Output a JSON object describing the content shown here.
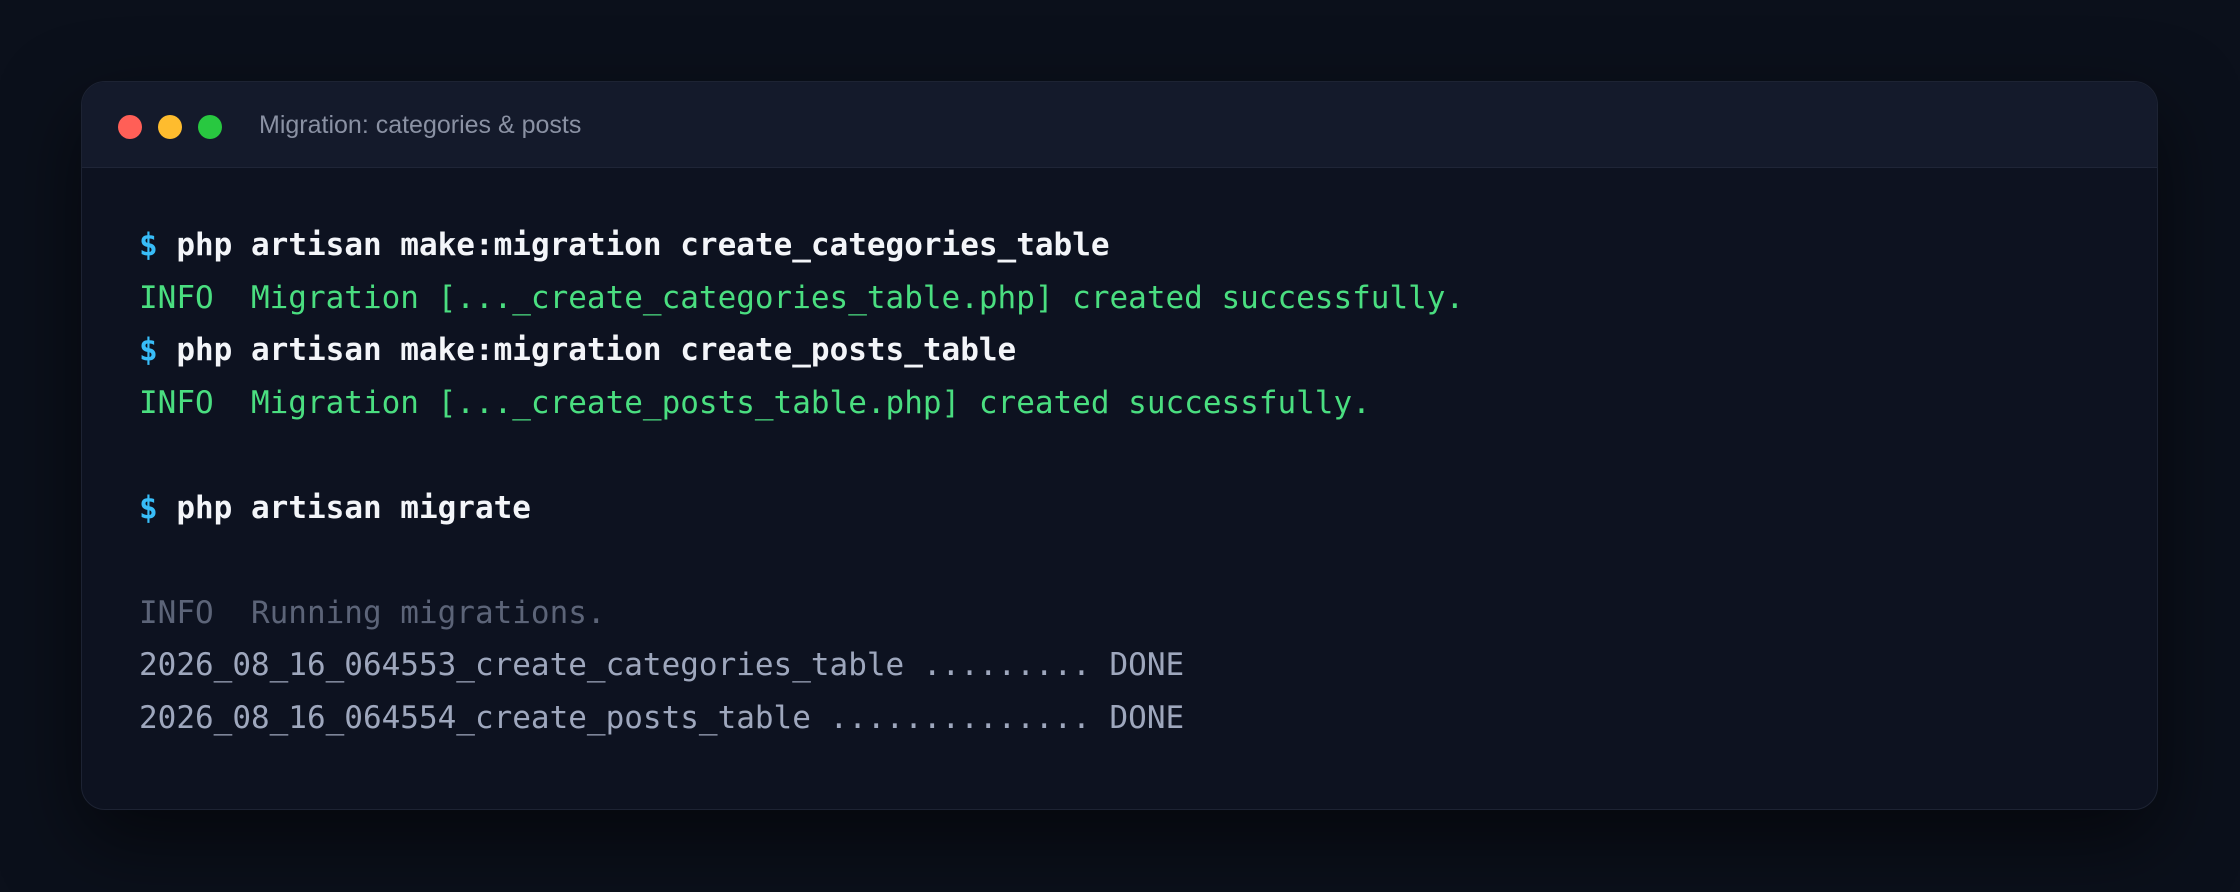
{
  "window": {
    "title": "Migration: categories & posts",
    "traffic_lights": {
      "close_color": "#ff5f57",
      "minimize_color": "#febc2e",
      "maximize_color": "#28c840"
    }
  },
  "terminal": {
    "prompt_symbol": "$",
    "lines": [
      {
        "kind": "command",
        "text": "php artisan make:migration create_categories_table"
      },
      {
        "kind": "success",
        "text": "INFO  Migration [..._create_categories_table.php] created successfully."
      },
      {
        "kind": "command",
        "text": "php artisan make:migration create_posts_table"
      },
      {
        "kind": "success",
        "text": "INFO  Migration [..._create_posts_table.php] created successfully."
      },
      {
        "kind": "blank",
        "text": ""
      },
      {
        "kind": "command",
        "text": "php artisan migrate"
      },
      {
        "kind": "blank",
        "text": ""
      },
      {
        "kind": "info",
        "text": "INFO  Running migrations."
      },
      {
        "kind": "plain",
        "text": "2026_08_16_064553_create_categories_table ......... DONE"
      },
      {
        "kind": "plain",
        "text": "2026_08_16_064554_create_posts_table .............. DONE"
      }
    ]
  },
  "colors": {
    "prompt": "#38bdf8",
    "command": "#f3f5f9",
    "success": "#4ade80",
    "info": "#5c6478",
    "plain": "#9ea7bd"
  }
}
